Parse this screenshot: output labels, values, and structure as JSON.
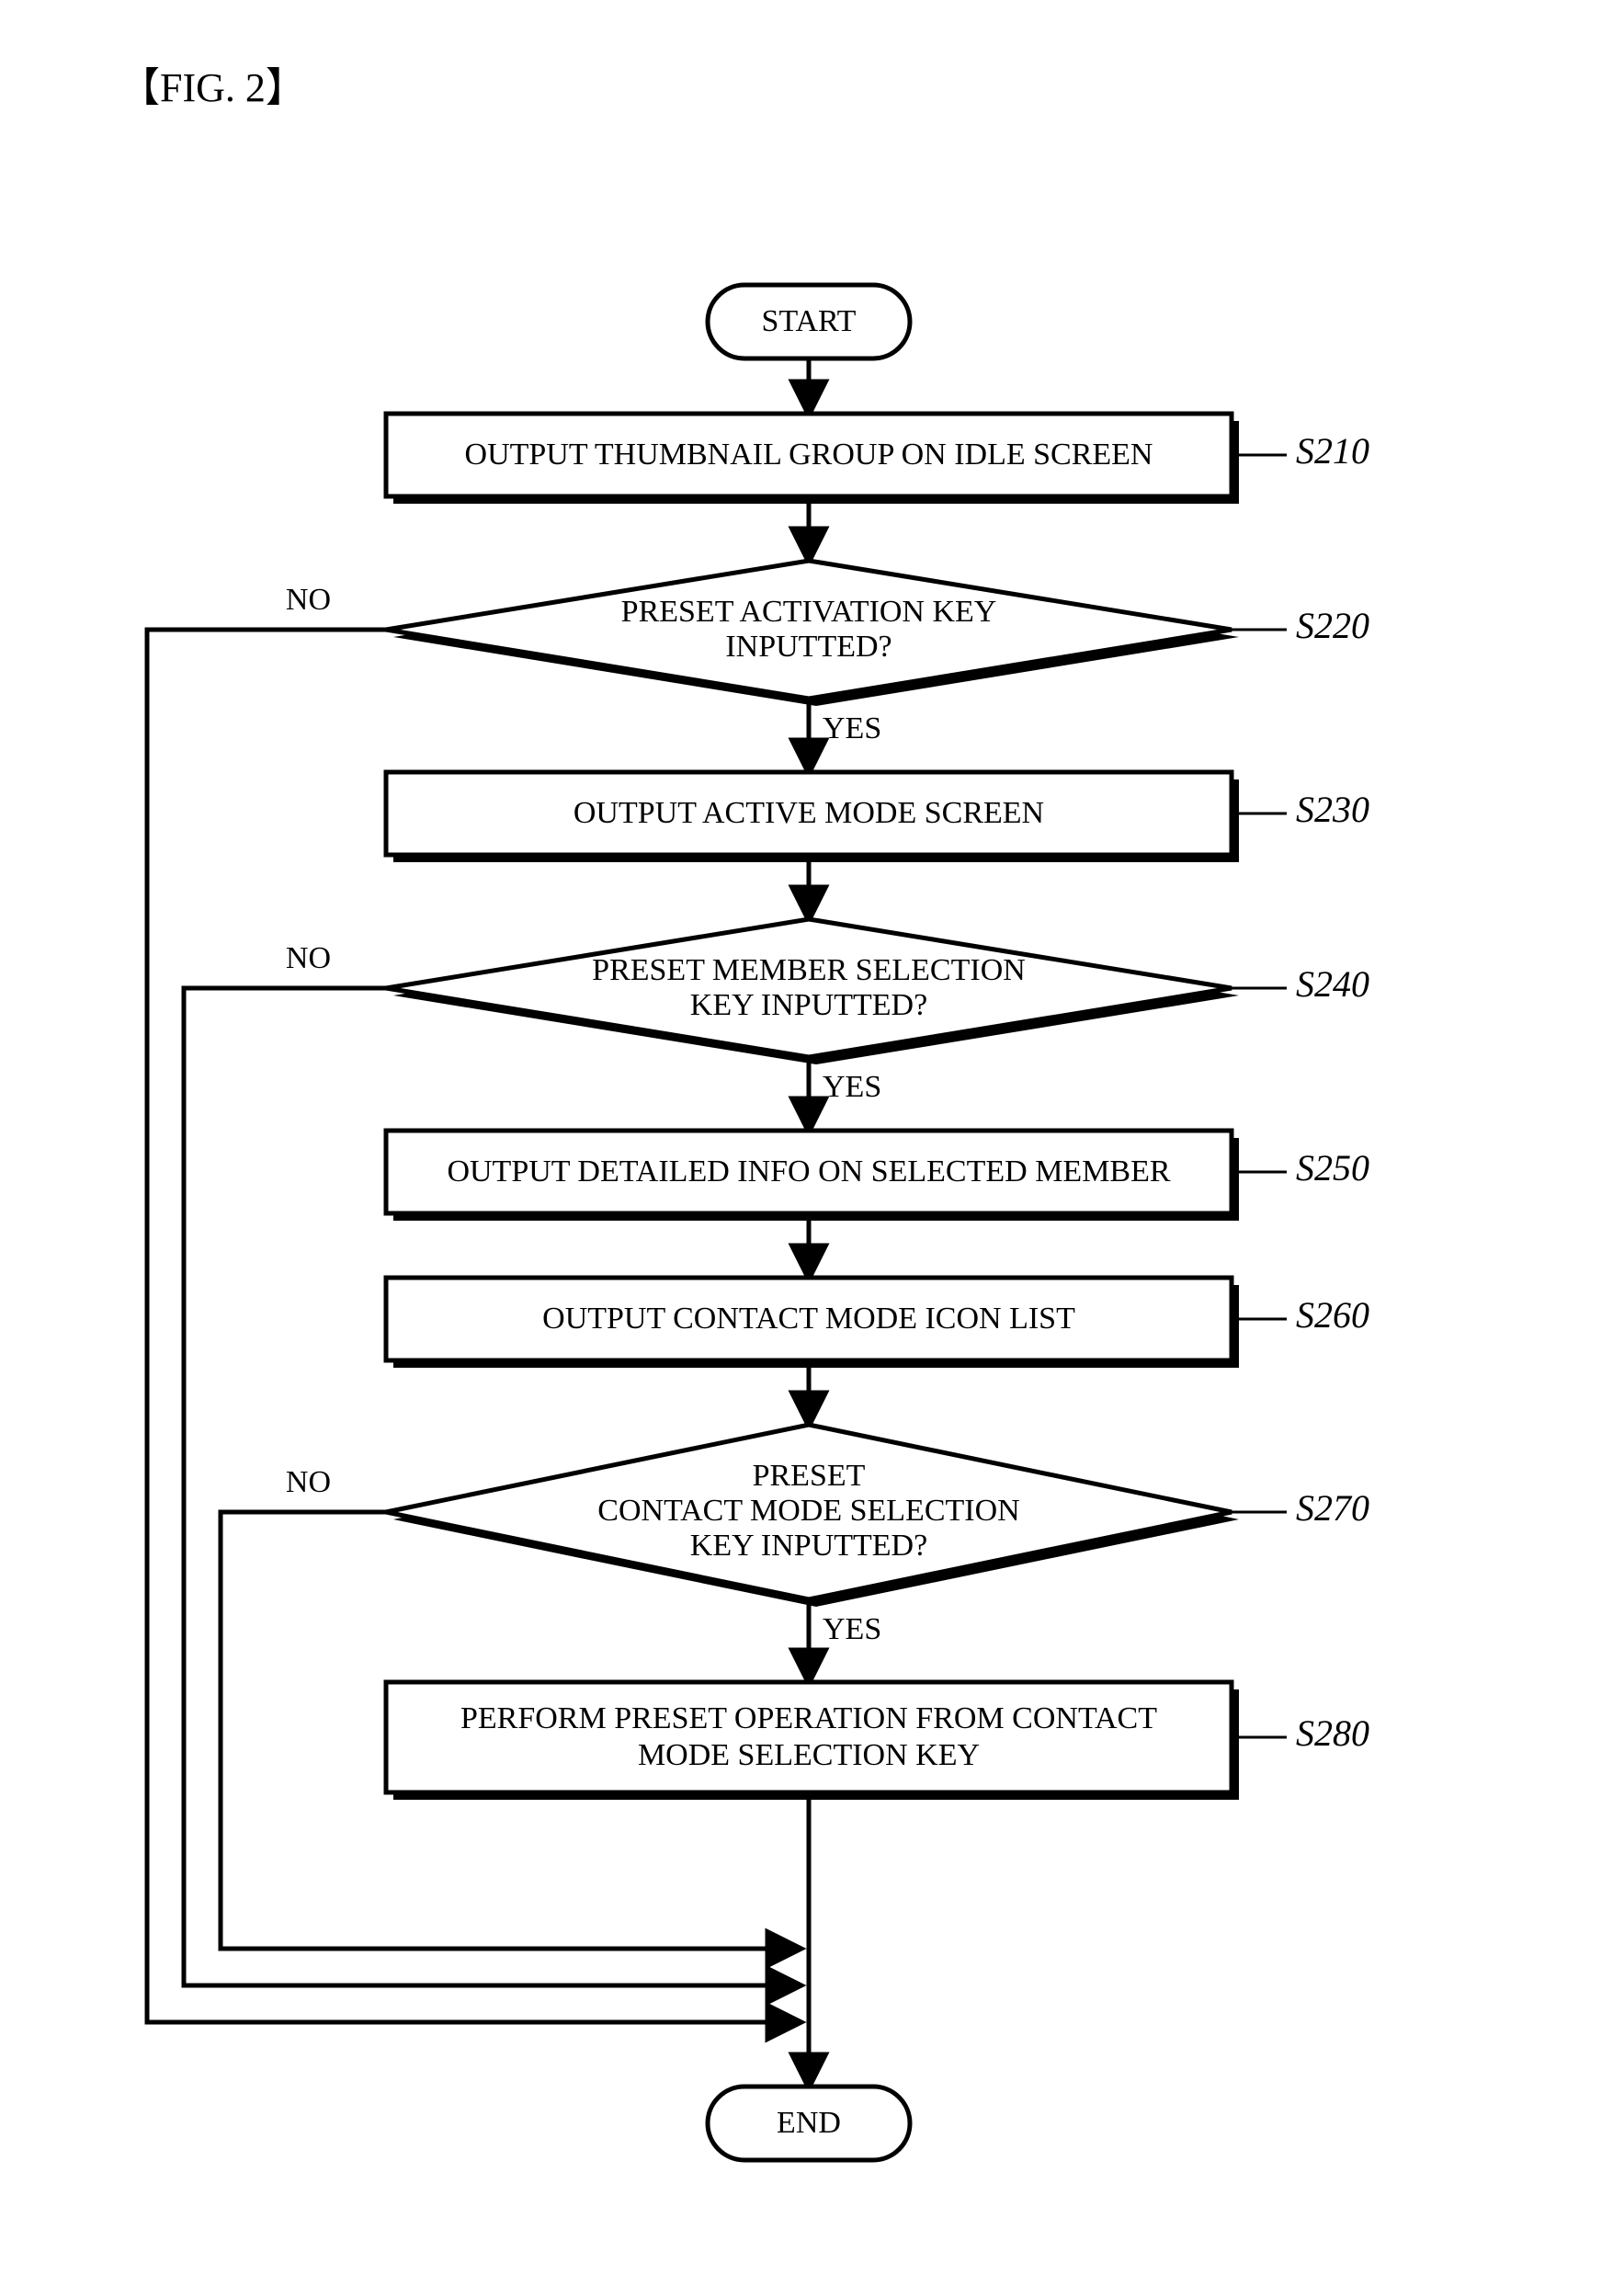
{
  "figure_label": "【FIG. 2】",
  "terminals": {
    "start": "START",
    "end": "END"
  },
  "steps": {
    "s210": {
      "label": "S210",
      "text": "OUTPUT THUMBNAIL GROUP ON IDLE SCREEN"
    },
    "s220": {
      "label": "S220",
      "line1": "PRESET ACTIVATION KEY",
      "line2": "INPUTTED?"
    },
    "s230": {
      "label": "S230",
      "text": "OUTPUT ACTIVE MODE SCREEN"
    },
    "s240": {
      "label": "S240",
      "line1": "PRESET MEMBER SELECTION",
      "line2": "KEY INPUTTED?"
    },
    "s250": {
      "label": "S250",
      "text": "OUTPUT DETAILED INFO ON SELECTED MEMBER"
    },
    "s260": {
      "label": "S260",
      "text": "OUTPUT CONTACT MODE ICON LIST"
    },
    "s270": {
      "label": "S270",
      "line1": "PRESET",
      "line2": "CONTACT MODE SELECTION",
      "line3": "KEY INPUTTED?"
    },
    "s280": {
      "label": "S280",
      "line1": "PERFORM PRESET OPERATION FROM CONTACT",
      "line2": "MODE SELECTION KEY"
    }
  },
  "branches": {
    "yes": "YES",
    "no": "NO"
  },
  "chart_data": {
    "type": "flowchart",
    "nodes": [
      {
        "id": "start",
        "kind": "terminal",
        "text": "START"
      },
      {
        "id": "S210",
        "kind": "process",
        "text": "OUTPUT THUMBNAIL GROUP ON IDLE SCREEN"
      },
      {
        "id": "S220",
        "kind": "decision",
        "text": "PRESET ACTIVATION KEY INPUTTED?"
      },
      {
        "id": "S230",
        "kind": "process",
        "text": "OUTPUT ACTIVE MODE SCREEN"
      },
      {
        "id": "S240",
        "kind": "decision",
        "text": "PRESET MEMBER SELECTION KEY INPUTTED?"
      },
      {
        "id": "S250",
        "kind": "process",
        "text": "OUTPUT DETAILED INFO ON SELECTED MEMBER"
      },
      {
        "id": "S260",
        "kind": "process",
        "text": "OUTPUT CONTACT MODE ICON LIST"
      },
      {
        "id": "S270",
        "kind": "decision",
        "text": "PRESET CONTACT MODE SELECTION KEY INPUTTED?"
      },
      {
        "id": "S280",
        "kind": "process",
        "text": "PERFORM PRESET OPERATION FROM CONTACT MODE SELECTION KEY"
      },
      {
        "id": "end",
        "kind": "terminal",
        "text": "END"
      }
    ],
    "edges": [
      {
        "from": "start",
        "to": "S210"
      },
      {
        "from": "S210",
        "to": "S220"
      },
      {
        "from": "S220",
        "to": "S230",
        "label": "YES"
      },
      {
        "from": "S220",
        "to": "end",
        "label": "NO"
      },
      {
        "from": "S230",
        "to": "S240"
      },
      {
        "from": "S240",
        "to": "S250",
        "label": "YES"
      },
      {
        "from": "S240",
        "to": "end",
        "label": "NO"
      },
      {
        "from": "S250",
        "to": "S260"
      },
      {
        "from": "S260",
        "to": "S270"
      },
      {
        "from": "S270",
        "to": "S280",
        "label": "YES"
      },
      {
        "from": "S270",
        "to": "end",
        "label": "NO"
      },
      {
        "from": "S280",
        "to": "end"
      }
    ]
  }
}
